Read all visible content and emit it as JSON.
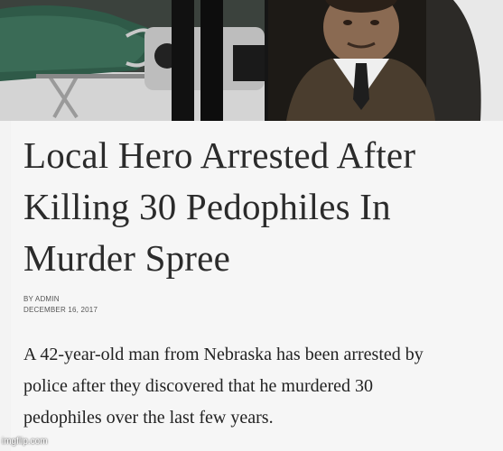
{
  "article": {
    "headline_lines": [
      "Local Hero Arrested After",
      "Killing 30 Pedophiles In",
      "Murder Spree"
    ],
    "byline": {
      "author": "BY ADMIN",
      "date": "DECEMBER 16, 2017"
    },
    "body_lines": [
      "A 42-year-old man from Nebraska has been arrested by",
      "police after they discovered that he murdered 30",
      "pedophiles over the last few years."
    ]
  },
  "watermark": "imgflip.com",
  "colors": {
    "page_background": "#f6f6f6",
    "headline_text": "#2b2b2b",
    "body_text": "#222222"
  }
}
